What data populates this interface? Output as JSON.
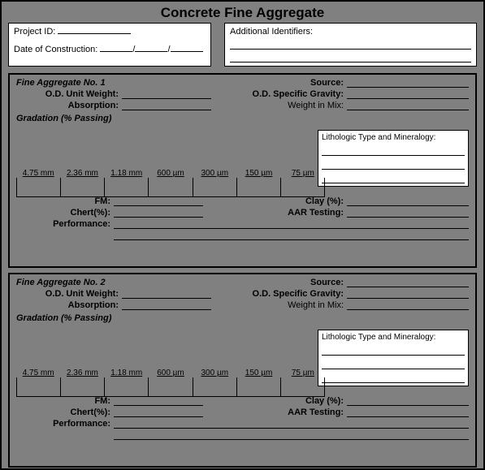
{
  "title": "Concrete Fine Aggregate",
  "header": {
    "project_id_label": "Project ID:",
    "date_label": "Date of Construction:",
    "additional_label": "Additional Identifiers:"
  },
  "sections": [
    {
      "heading": "Fine Aggregate No. 1",
      "source_label": "Source:",
      "odw_label": "O.D. Unit Weight:",
      "odsg_label": "O.D. Specific Gravity:",
      "abs_label": "Absorption:",
      "wim_label": "Weight in Mix:",
      "grad_label": "Gradation (% Passing)",
      "litho_label": "Lithologic Type and Mineralogy:",
      "grad_cols": [
        "4.75 mm",
        "2.36 mm",
        "1.18 mm",
        "600 µm",
        "300 µm",
        "150 µm",
        "75 µm"
      ],
      "fm_label": "FM:",
      "clay_label": "Clay (%):",
      "chert_label": "Chert(%):",
      "aar_label": "AAR Testing:",
      "perf_label": "Performance:"
    },
    {
      "heading": "Fine Aggregate No. 2",
      "source_label": "Source:",
      "odw_label": "O.D. Unit Weight:",
      "odsg_label": "O.D. Specific Gravity:",
      "abs_label": "Absorption:",
      "wim_label": "Weight in Mix:",
      "grad_label": "Gradation (% Passing)",
      "litho_label": "Lithologic Type and Mineralogy:",
      "grad_cols": [
        "4.75 mm",
        "2.36 mm",
        "1.18 mm",
        "600 µm",
        "300 µm",
        "150 µm",
        "75 µm"
      ],
      "fm_label": "FM:",
      "clay_label": "Clay (%):",
      "chert_label": "Chert(%):",
      "aar_label": "AAR Testing:",
      "perf_label": "Performance:"
    }
  ]
}
